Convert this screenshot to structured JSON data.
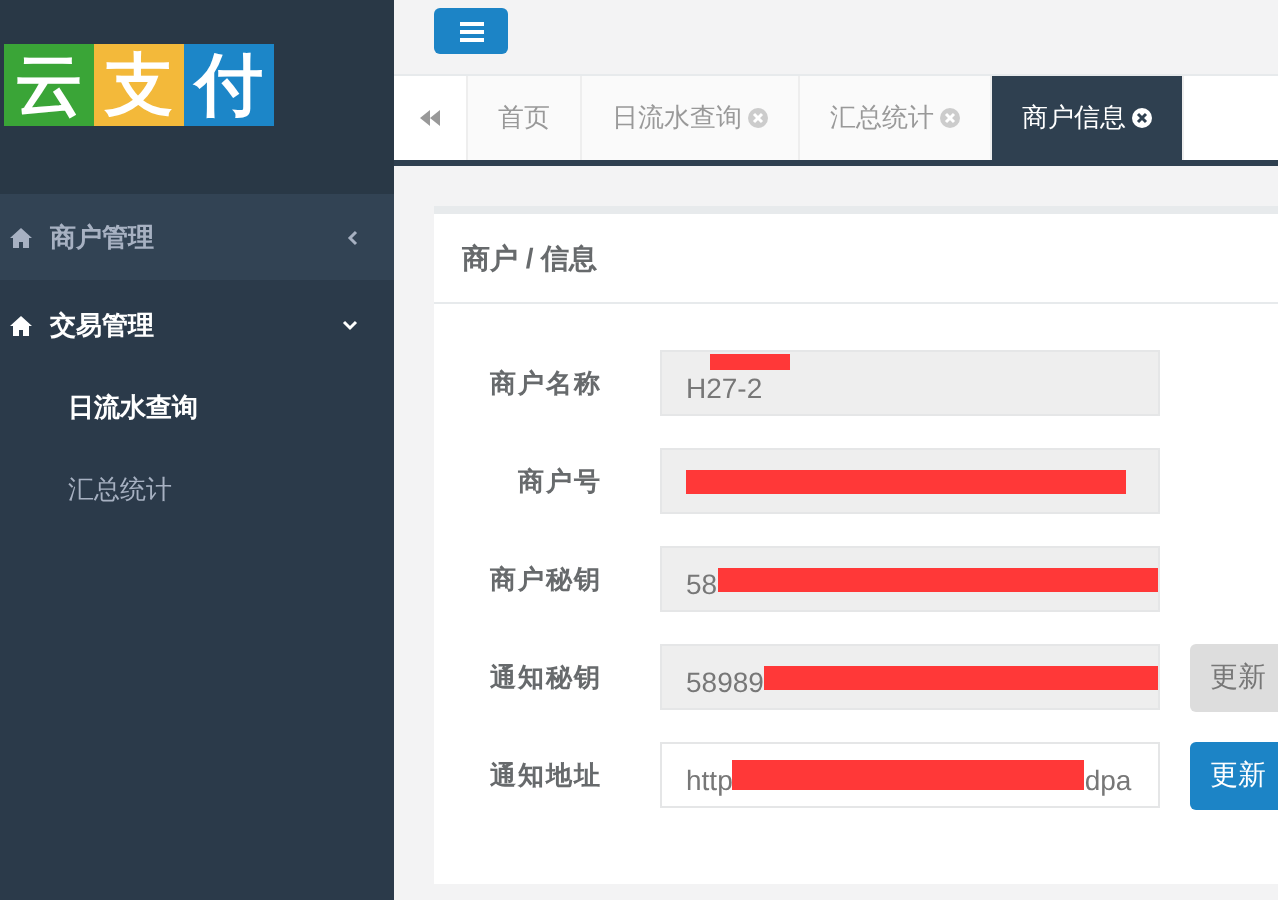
{
  "sidebar": {
    "logo": [
      {
        "char": "云",
        "color": "#3aa537"
      },
      {
        "char": "支",
        "color": "#f3b93a"
      },
      {
        "char": "付",
        "color": "#1c86c8"
      }
    ],
    "menu": [
      {
        "label": "商户管理",
        "expanded": false
      },
      {
        "label": "交易管理",
        "expanded": true,
        "children": [
          {
            "label": "日流水查询",
            "selected": true
          },
          {
            "label": "汇总统计",
            "selected": false
          }
        ]
      }
    ]
  },
  "tabs": [
    {
      "label": "首页",
      "closable": false,
      "selected": false
    },
    {
      "label": "日流水查询",
      "closable": true,
      "selected": false
    },
    {
      "label": "汇总统计",
      "closable": true,
      "selected": false
    },
    {
      "label": "商户信息",
      "closable": true,
      "selected": true
    }
  ],
  "card": {
    "title": "商户 / 信息",
    "fields": [
      {
        "label": "商户名称",
        "value": "H27-2",
        "readonly": true,
        "redacted": true,
        "redaction_above_value": true
      },
      {
        "label": "商户号",
        "readonly": true,
        "redacted": true,
        "redaction_above_value": false
      },
      {
        "label": "商户秘钥",
        "value": "58",
        "readonly": true,
        "redacted": true,
        "redaction_above_value": false
      },
      {
        "label": "通知秘钥",
        "value": "58989",
        "readonly": true,
        "redacted": true,
        "redaction_above_value": false,
        "button": {
          "label": "更新",
          "kind": "default"
        }
      },
      {
        "label": "通知地址",
        "value": "http",
        "value_tail": "dpa",
        "readonly": false,
        "redacted": true,
        "redaction_above_value": false,
        "button": {
          "label": "更新",
          "kind": "primary"
        }
      }
    ]
  }
}
